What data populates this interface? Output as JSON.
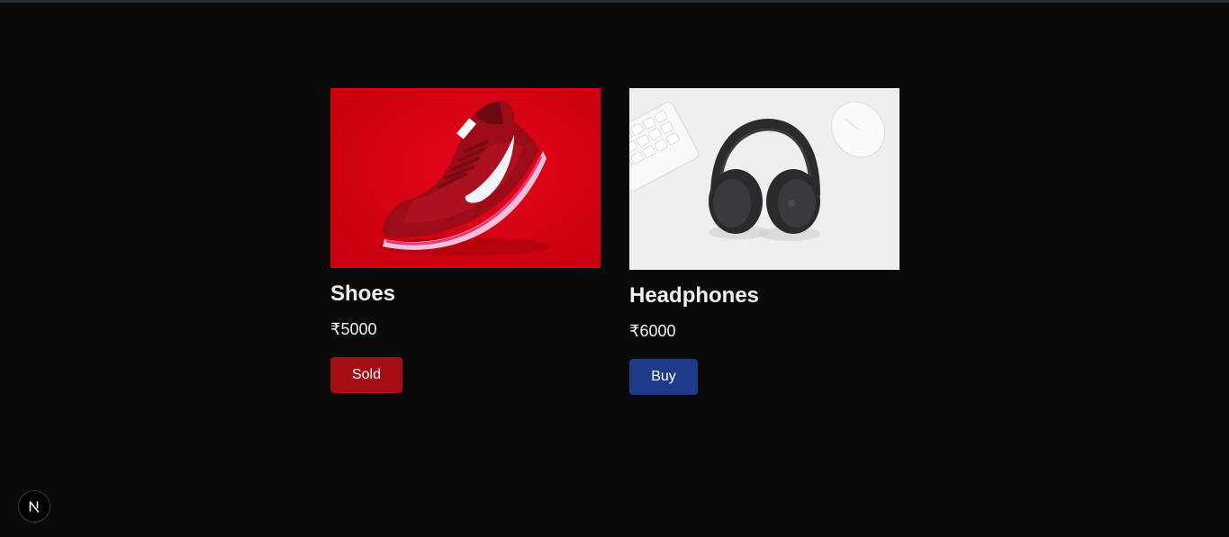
{
  "products": [
    {
      "name": "Shoes",
      "price": "₹5000",
      "button_label": "Sold",
      "button_color": "#a50e15",
      "image": "red-sneaker-image",
      "image_bg": "#d50013"
    },
    {
      "name": "Headphones",
      "price": "₹6000",
      "button_label": "Buy",
      "button_color": "#1e3a8a",
      "image": "headphones-keyboard-image",
      "image_bg": "#eeeeee"
    }
  ],
  "dev_badge": {
    "icon": "nextjs-logo-icon",
    "letter": "N"
  }
}
